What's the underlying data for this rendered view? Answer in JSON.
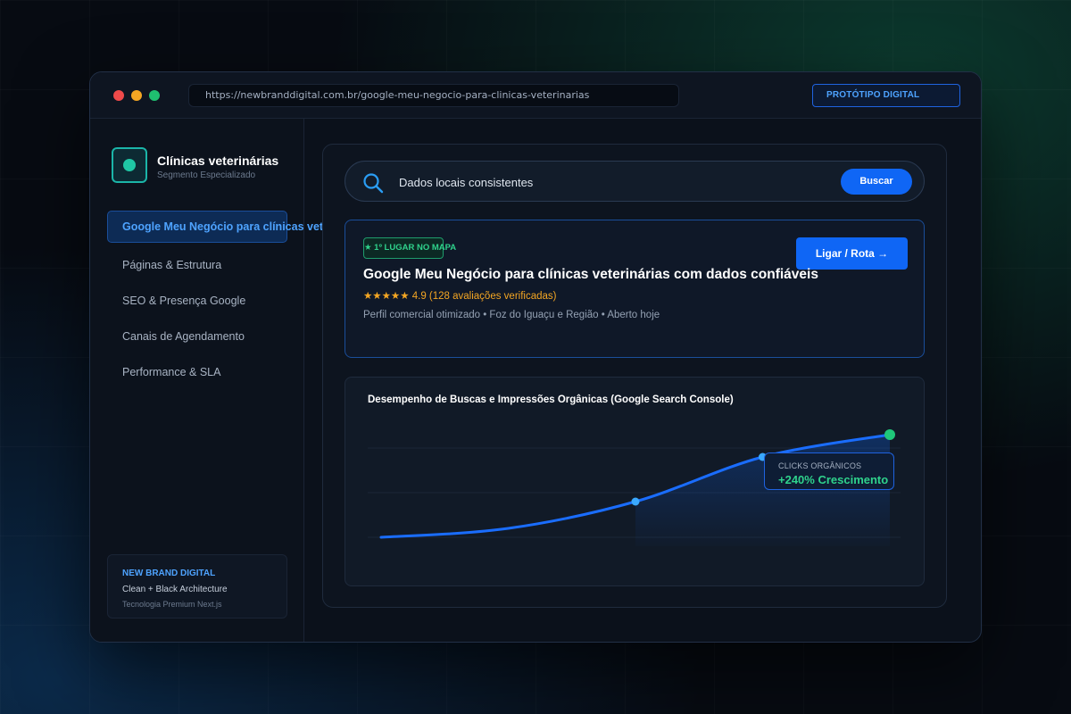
{
  "browser": {
    "url": "https://newbranddigital.com.br/google-meu-negocio-para-clinicas-veterinarias",
    "badge": "PROTÓTIPO DIGITAL"
  },
  "sidebar": {
    "brand_title": "Clínicas veterinárias",
    "brand_subtitle": "Segmento Especializado",
    "items": [
      {
        "label": "Google Meu Negócio para clínicas veterinárias",
        "active": true
      },
      {
        "label": "Páginas & Estrutura"
      },
      {
        "label": "SEO & Presença Google"
      },
      {
        "label": "Canais de Agendamento"
      },
      {
        "label": "Performance & SLA"
      }
    ],
    "footer": {
      "title": "NEW BRAND DIGITAL",
      "line1": "Clean + Black Architecture",
      "line2": "Tecnologia Premium Next.js"
    }
  },
  "search": {
    "query": "Dados locais consistentes",
    "button": "Buscar"
  },
  "listing": {
    "badge": "★ 1º LUGAR NO MAPA",
    "cta": "Ligar / Rota →",
    "title": "Google Meu Negócio para clínicas veterinárias com dados confiáveis",
    "rating": "★★★★★ 4.9 (128 avaliações verificadas)",
    "meta": "Perfil comercial otimizado • Foz do Iguaçu e Região • Aberto hoje"
  },
  "chart": {
    "title": "Desempenho de Buscas e Impressões Orgânicas (Google Search Console)",
    "tooltip_label": "CLICKS ORGÂNICOS",
    "tooltip_value": "+240% Crescimento"
  },
  "colors": {
    "accent": "#0f66f5",
    "success": "#2fd28c",
    "rating": "#f4a623"
  },
  "chart_data": {
    "type": "line",
    "title": "Desempenho de Buscas e Impressões Orgânicas (Google Search Console)",
    "x": [
      0,
      1,
      2,
      3,
      4
    ],
    "y": [
      10,
      20,
      50,
      100,
      125
    ],
    "highlighted_points": [
      2,
      3,
      4
    ],
    "ylim": [
      0,
      150
    ],
    "grid": true
  }
}
